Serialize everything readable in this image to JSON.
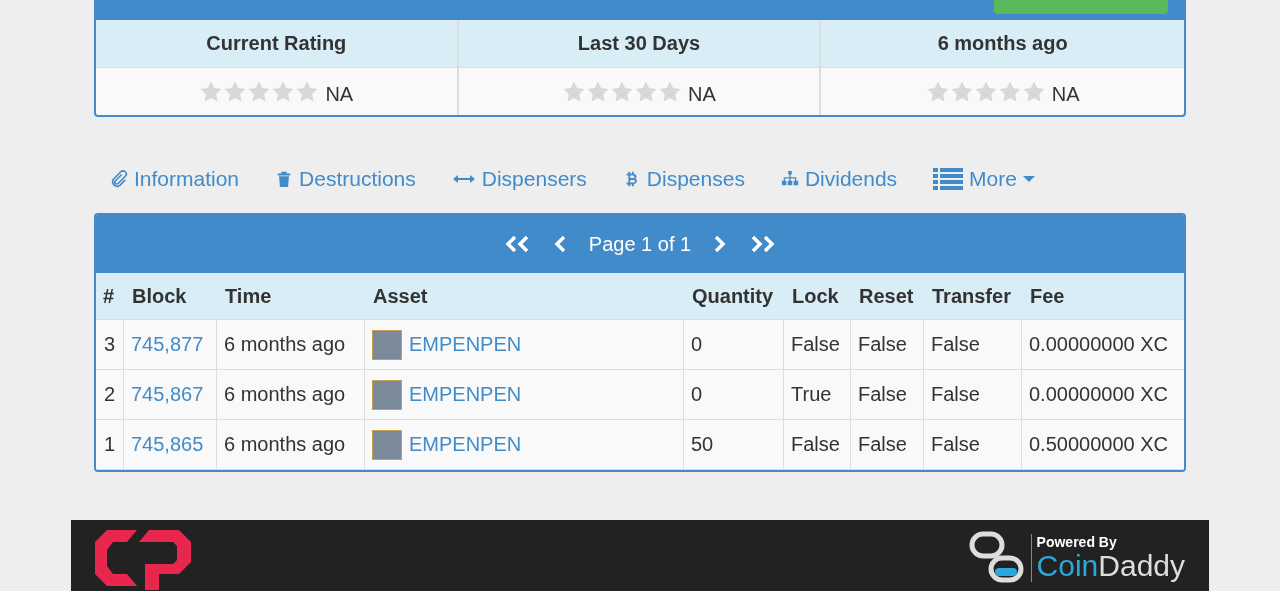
{
  "ratings": {
    "columns": [
      "Current Rating",
      "Last 30 Days",
      "6 months ago"
    ],
    "values": [
      {
        "stars": 0,
        "text": "NA"
      },
      {
        "stars": 0,
        "text": "NA"
      },
      {
        "stars": 0,
        "text": "NA"
      }
    ]
  },
  "tabs": [
    "Information",
    "Destructions",
    "Dispensers",
    "Dispenses",
    "Dividends",
    "More"
  ],
  "pager": {
    "text": "Page 1 of 1"
  },
  "table": {
    "columns": [
      "#",
      "Block",
      "Time",
      "Asset",
      "Quantity",
      "Lock",
      "Reset",
      "Transfer",
      "Fee"
    ],
    "rows": [
      {
        "num": "3",
        "block": "745,877",
        "time": "6 months ago",
        "asset": "EMPENPEN",
        "quantity": "0",
        "lock": "False",
        "reset": "False",
        "transfer": "False",
        "fee": "0.00000000 XC"
      },
      {
        "num": "2",
        "block": "745,867",
        "time": "6 months ago",
        "asset": "EMPENPEN",
        "quantity": "0",
        "lock": "True",
        "reset": "False",
        "transfer": "False",
        "fee": "0.00000000 XC"
      },
      {
        "num": "1",
        "block": "745,865",
        "time": "6 months ago",
        "asset": "EMPENPEN",
        "quantity": "50",
        "lock": "False",
        "reset": "False",
        "transfer": "False",
        "fee": "0.50000000 XC"
      }
    ]
  },
  "footer": {
    "powered_by": "Powered By",
    "brand": [
      "Coin",
      "Daddy"
    ]
  }
}
